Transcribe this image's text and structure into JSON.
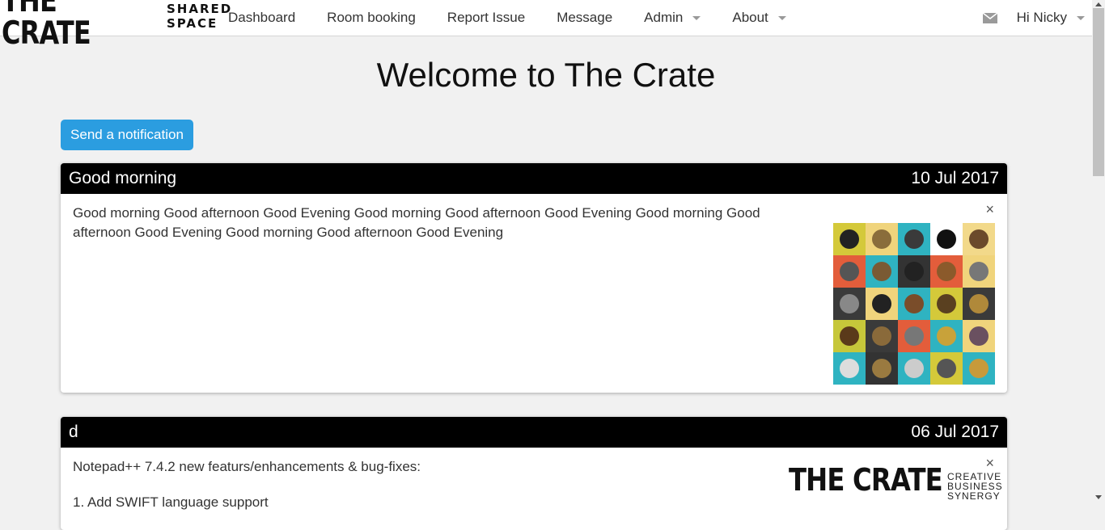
{
  "brand": {
    "main": "THE CRATE",
    "sub_line1": "SHARED",
    "sub_line2": "SPACE"
  },
  "nav": {
    "items": [
      {
        "label": "Dashboard"
      },
      {
        "label": "Room booking"
      },
      {
        "label": "Report Issue"
      },
      {
        "label": "Message"
      },
      {
        "label": "Admin"
      },
      {
        "label": "About"
      }
    ],
    "user_greeting": "Hi Nicky",
    "mail_icon": "envelope-icon"
  },
  "page": {
    "title": "Welcome to The Crate",
    "send_button": "Send a notification"
  },
  "notifications": [
    {
      "title": "Good morning",
      "date": "10 Jul 2017",
      "body": "Good morning Good afternoon Good Evening Good morning Good afternoon Good Evening Good morning Good afternoon Good Evening Good morning Good afternoon Good Evening",
      "close": "×",
      "image": "animal-faces-grid"
    },
    {
      "title": "d",
      "date": "06 Jul 2017",
      "body": "Notepad++ 7.4.2 new featurs/enhancements & bug-fixes:",
      "body_line2": "1. Add SWIFT language support",
      "close": "×",
      "image": "the-crate-logo",
      "logo_main": "THE CRATE",
      "logo_sub": [
        "CREATIVE",
        "BUSINESS",
        "SYNERGY"
      ]
    }
  ],
  "colors": {
    "accent": "#2b9de0",
    "card_header": "#000000",
    "background": "#f1f1f1",
    "animal_tiles": [
      "#d4c93a",
      "#f0d47c",
      "#2fb3c1",
      "#ffffff",
      "#f2d98a",
      "#e35d3b",
      "#2fb3c1",
      "#333333",
      "#e35d3b",
      "#f0d47c",
      "#3a3a3a",
      "#f0d47c",
      "#2fb3c1",
      "#d4c93a",
      "#3a3a3a",
      "#c6c73a",
      "#3a3a3a",
      "#e35d3b",
      "#2fb3c1",
      "#f0d47c",
      "#2fb3c1",
      "#333333",
      "#2fb3c1",
      "#d4c93a",
      "#2fb3c1"
    ]
  }
}
